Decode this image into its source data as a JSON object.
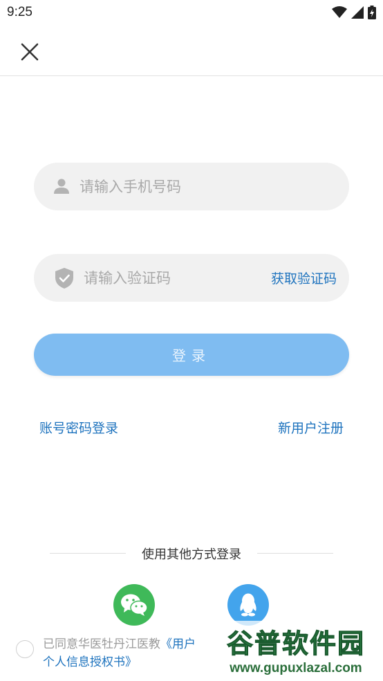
{
  "status_bar": {
    "time": "9:25",
    "icons": [
      "wifi-icon",
      "signal-icon",
      "battery-charging-icon"
    ]
  },
  "header": {
    "close_icon": "close-icon"
  },
  "form": {
    "phone": {
      "placeholder": "请输入手机号码",
      "value": "",
      "icon": "user-icon"
    },
    "code": {
      "placeholder": "请输入验证码",
      "value": "",
      "icon": "shield-check-icon",
      "get_code_label": "获取验证码"
    },
    "login_label": "登录"
  },
  "links": {
    "password_login": "账号密码登录",
    "register": "新用户注册"
  },
  "other_login": {
    "title": "使用其他方式登录",
    "methods": [
      {
        "icon": "wechat-icon",
        "color": "#3fb959"
      },
      {
        "icon": "qq-icon",
        "color": "#43a4ec"
      }
    ]
  },
  "agreement": {
    "prefix": "已同意华医牡丹江医教",
    "doc1": "《用户",
    "doc2": "个人信息授权书》",
    "checked": false
  },
  "watermark": {
    "title": "谷普软件园",
    "url": "www.gupuxlazal.com"
  },
  "colors": {
    "accent": "#1e73be",
    "login_button": "#7fbcf1",
    "field_background": "#f1f1f1"
  }
}
